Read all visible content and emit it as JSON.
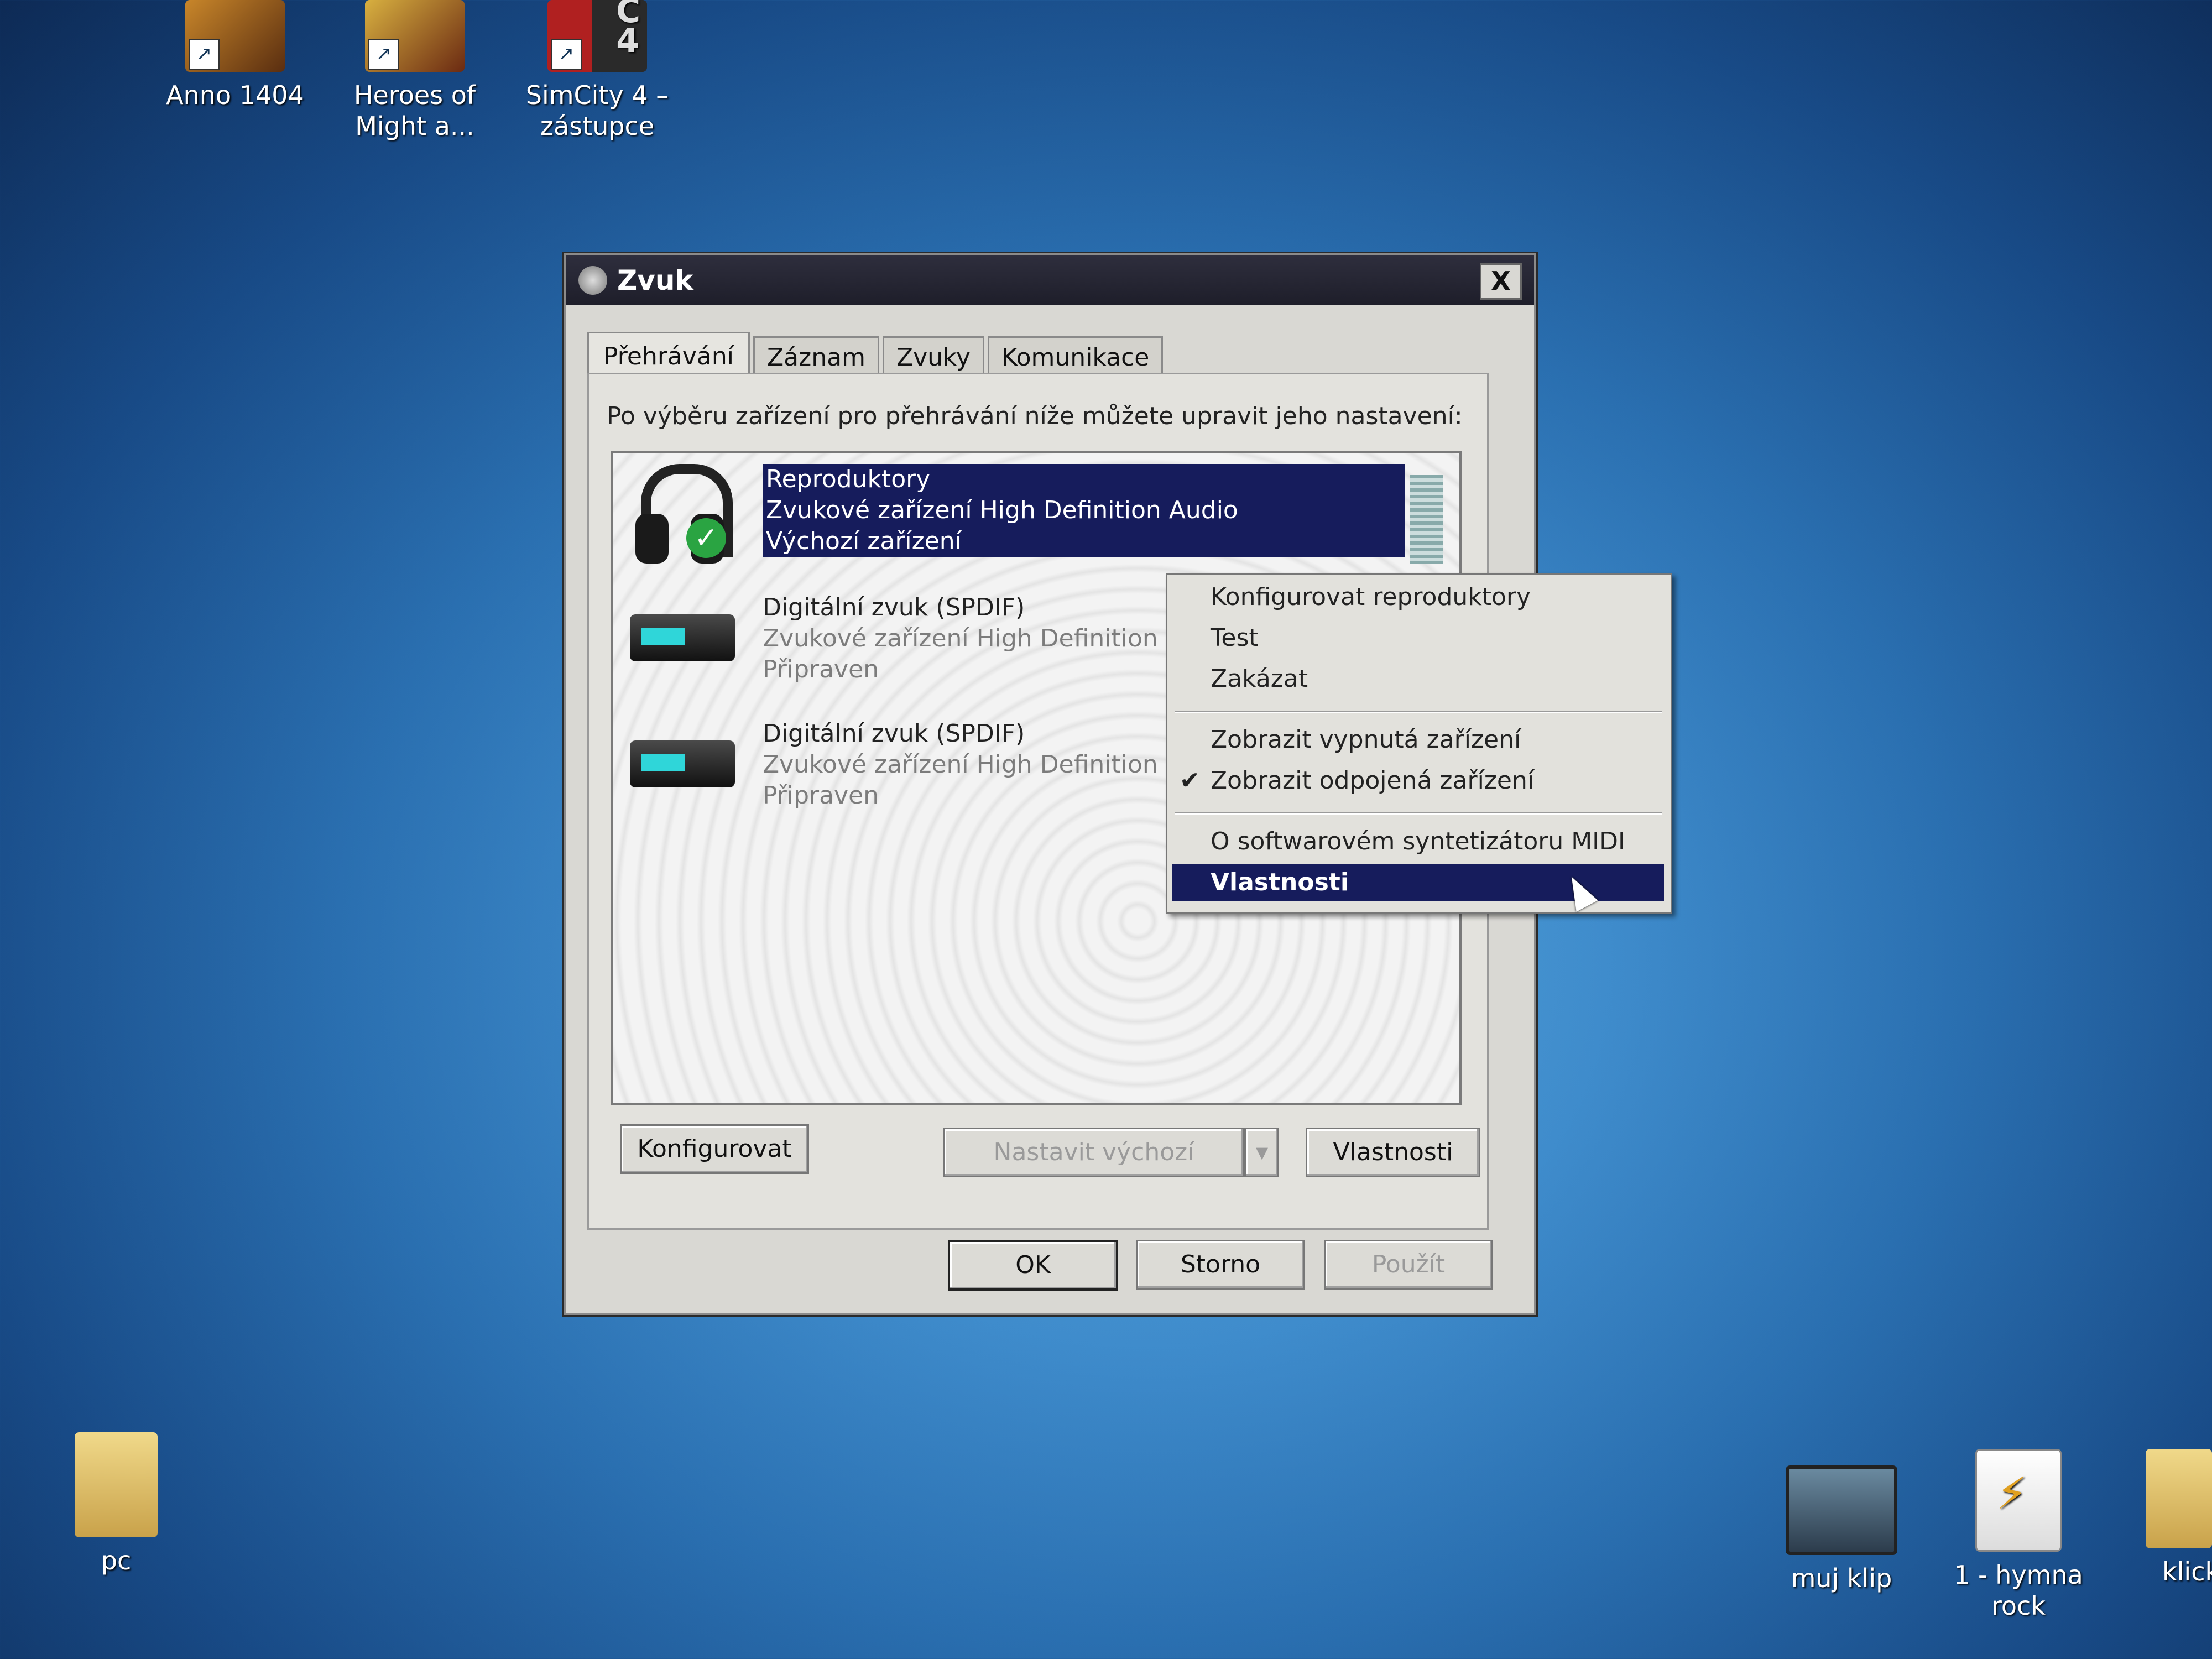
{
  "desktop": {
    "icons": [
      {
        "label_line1": "Anno 1404",
        "label_line2": ""
      },
      {
        "label_line1": "Heroes of",
        "label_line2": "Might a..."
      },
      {
        "label_line1": "SimCity 4 –",
        "label_line2": "zástupce"
      },
      {
        "label_line1": "pc",
        "label_line2": ""
      },
      {
        "label_line1": "muj klip",
        "label_line2": ""
      },
      {
        "label_line1": "1 - hymna rock",
        "label_line2": ""
      },
      {
        "label_line1": "klick",
        "label_line2": ""
      }
    ],
    "simcity_badge_letter": "C",
    "simcity_badge_number": "4"
  },
  "dialog": {
    "title": "Zvuk",
    "close_label": "X",
    "tabs": [
      "Přehrávání",
      "Záznam",
      "Zvuky",
      "Komunikace"
    ],
    "instruction": "Po výběru zařízení pro přehrávání níže můžete upravit jeho nastavení:",
    "devices": [
      {
        "name": "Reproduktory",
        "desc": "Zvukové zařízení High Definition Audio",
        "status": "Výchozí zařízení"
      },
      {
        "name": "Digitální zvuk (SPDIF)",
        "desc": "Zvukové zařízení High Definition Audio",
        "status": "Připraven"
      },
      {
        "name": "Digitální zvuk (SPDIF)",
        "desc": "Zvukové zařízení High Definition Audio",
        "status": "Připraven"
      }
    ],
    "configure_button": "Konfigurovat",
    "set_default_button": "Nastavit výchozí",
    "properties_button": "Vlastnosti",
    "ok_button": "OK",
    "cancel_button": "Storno",
    "apply_button": "Použít"
  },
  "context_menu": {
    "items": [
      {
        "label": "Konfigurovat reproduktory"
      },
      {
        "label": "Test"
      },
      {
        "label": "Zakázat"
      },
      {
        "label": "Zobrazit vypnutá zařízení"
      },
      {
        "label": "Zobrazit odpojená zařízení",
        "checked": true
      },
      {
        "label": "O softwarovém syntetizátoru MIDI"
      },
      {
        "label": "Vlastnosti",
        "highlighted": true
      }
    ],
    "check_glyph": "✔"
  },
  "colors": {
    "selection": "#161c5c",
    "dialog_bg": "#d9d8d3",
    "titlebar": "#1e1e2a"
  },
  "icons": {
    "default_device_check": "✓",
    "dropdown_arrow": "▾"
  }
}
